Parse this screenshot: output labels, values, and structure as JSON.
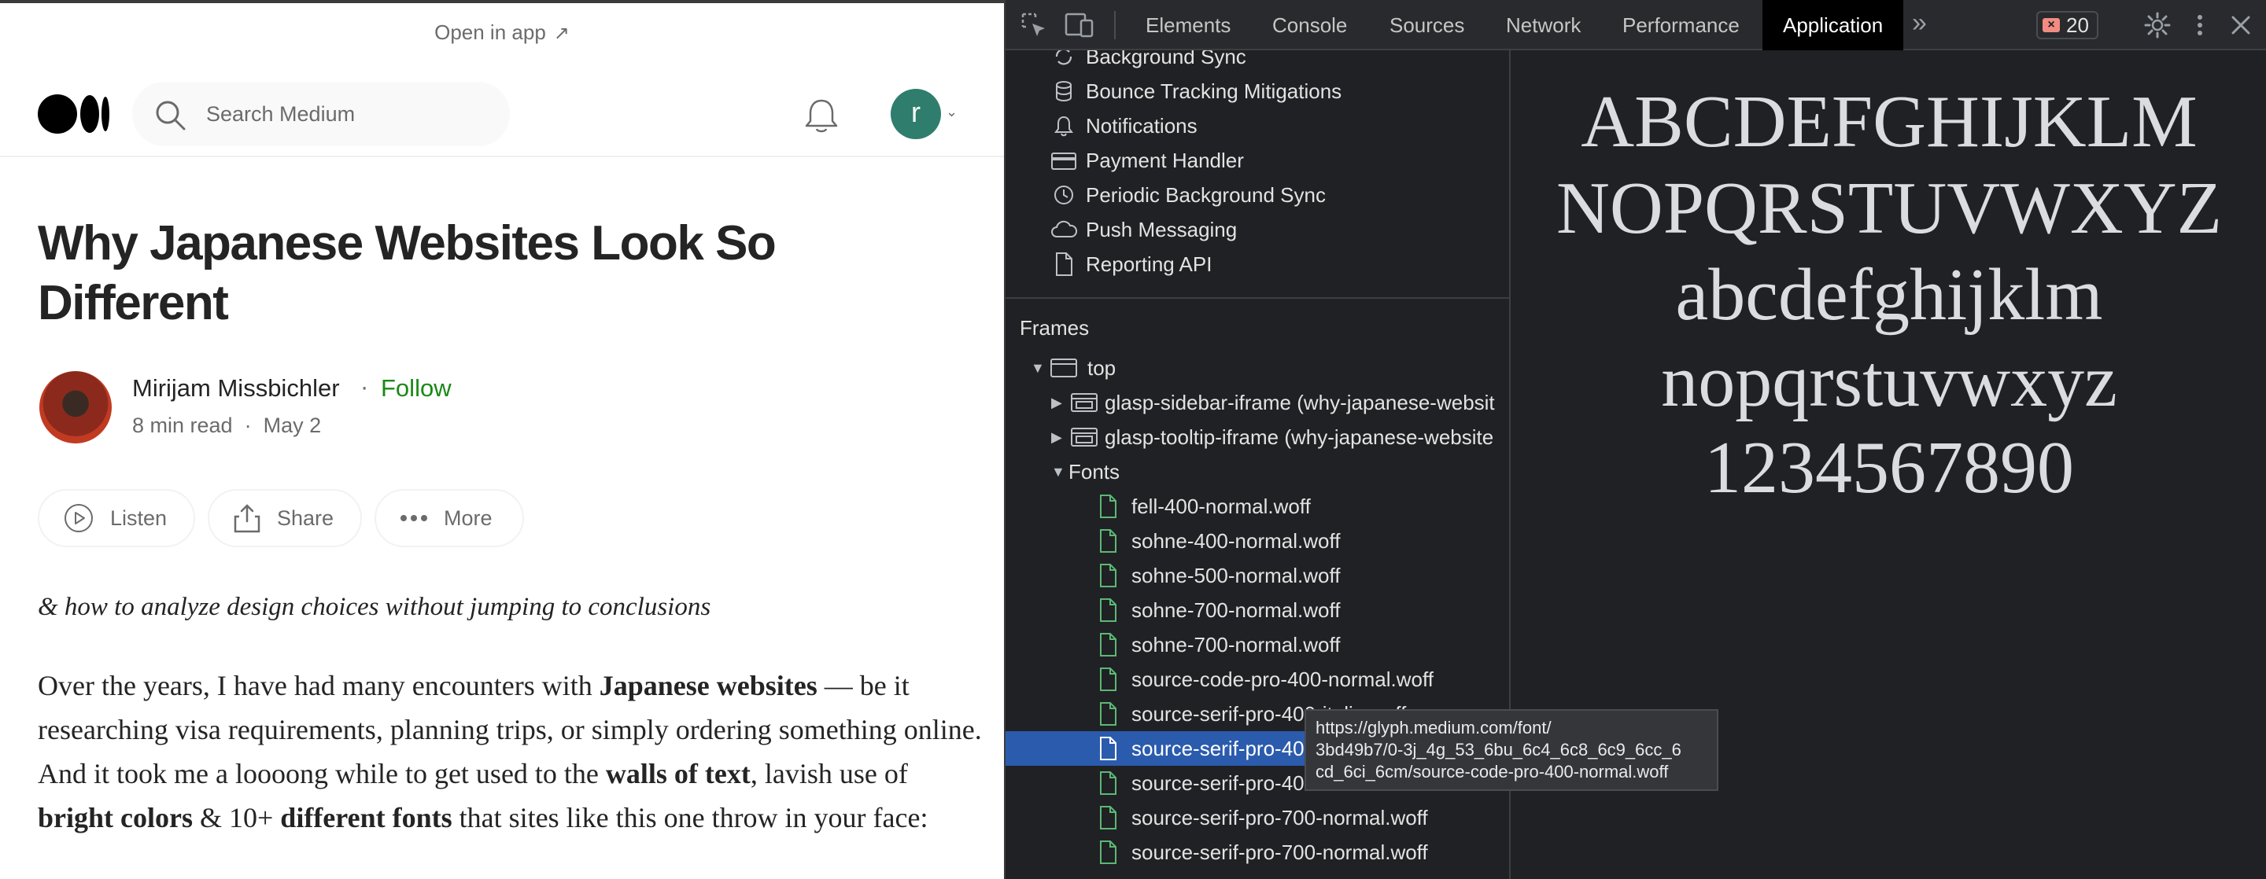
{
  "page": {
    "open_in_app": "Open in app",
    "search_placeholder": "Search Medium",
    "user_initial": "r",
    "title": "Why Japanese Websites Look So Different",
    "author": {
      "name": "Mirijam Missbichler",
      "follow": "Follow",
      "read_time": "8 min read",
      "date": "May 2"
    },
    "actions": {
      "listen": "Listen",
      "share": "Share",
      "more": "More"
    },
    "subtitle": "& how to analyze design choices without jumping to conclusions",
    "body": {
      "t1": "Over the years, I have had many encounters with ",
      "b1": "Japanese websites",
      "t2": " — be it researching visa requirements, planning trips, or simply ordering something online. And it took me a loooong while to get used to the ",
      "b2": "walls of text",
      "t3": ", lavish use of ",
      "b3": "bright colors",
      "t4": " & 10+ ",
      "b4": "different fonts",
      "t5": " that sites like this one throw in your face:"
    }
  },
  "devtools": {
    "tabs": [
      "Elements",
      "Console",
      "Sources",
      "Network",
      "Performance",
      "Application"
    ],
    "active_tab": "Application",
    "error_count": "20",
    "app_items": [
      {
        "label": "Background Sync",
        "icon": "sync-icon"
      },
      {
        "label": "Bounce Tracking Mitigations",
        "icon": "database-icon"
      },
      {
        "label": "Notifications",
        "icon": "bell-icon"
      },
      {
        "label": "Payment Handler",
        "icon": "card-icon"
      },
      {
        "label": "Periodic Background Sync",
        "icon": "clock-icon"
      },
      {
        "label": "Push Messaging",
        "icon": "cloud-icon"
      },
      {
        "label": "Reporting API",
        "icon": "file-icon"
      }
    ],
    "frames_label": "Frames",
    "frame_top": "top",
    "iframes": [
      "glasp-sidebar-iframe (why-japanese-websit",
      "glasp-tooltip-iframe (why-japanese-website"
    ],
    "fonts_label": "Fonts",
    "fonts": [
      "fell-400-normal.woff",
      "sohne-400-normal.woff",
      "sohne-500-normal.woff",
      "sohne-700-normal.woff",
      "sohne-700-normal.woff",
      "source-code-pro-400-normal.woff",
      "source-serif-pro-400-italic.woff",
      "source-serif-pro-400-normal.woff",
      "source-serif-pro-400-normal.woff",
      "source-serif-pro-700-normal.woff",
      "source-serif-pro-700-normal.woff"
    ],
    "selected_font_index": 7,
    "preview_lines": [
      "ABCDEFGHIJKLM",
      "NOPQRSTUVWXYZ",
      "abcdefghijklm",
      "nopqrstuvwxyz",
      "1234567890"
    ],
    "tooltip": [
      "https://glyph.medium.com/font/",
      "3bd49b7/0-3j_4g_53_6bu_6c4_6c8_6c9_6cc_6",
      "cd_6ci_6cm/source-code-pro-400-normal.woff"
    ]
  },
  "colors": {
    "follow_green": "#1a8917",
    "selection_blue": "#2b5bad",
    "font_file_green": "#5bb974",
    "avatar_teal": "#2f7d6d"
  }
}
